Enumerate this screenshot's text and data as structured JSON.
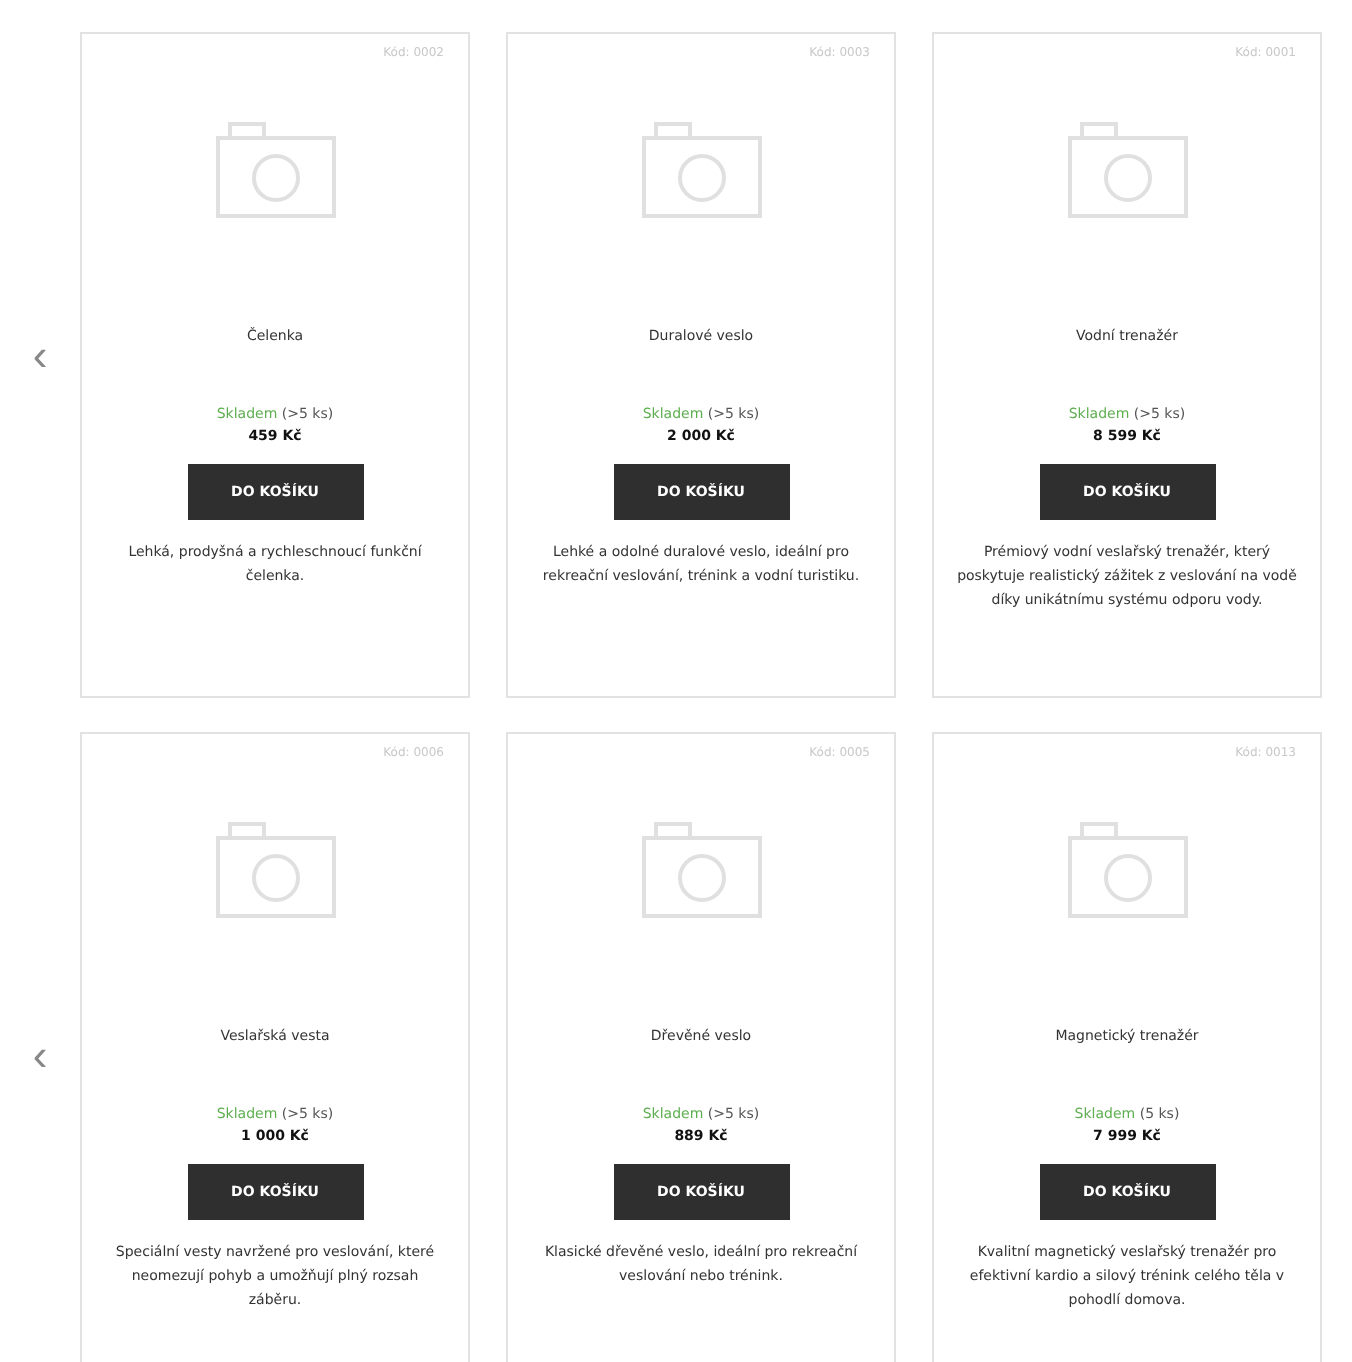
{
  "rows": [
    {
      "prev_arrow": "‹",
      "products": [
        {
          "code": "Kód: 0002",
          "name": "Čelenka",
          "stock_status": "Skladem",
          "stock_count": "(>5 ks)",
          "price": "459 Kč",
          "button": "DO KOŠÍKU",
          "description": "Lehká, prodyšná a rychleschnoucí funkční čelenka."
        },
        {
          "code": "Kód: 0003",
          "name": "Duralové veslo",
          "stock_status": "Skladem",
          "stock_count": "(>5 ks)",
          "price": "2 000 Kč",
          "button": "DO KOŠÍKU",
          "description": "Lehké a odolné duralové veslo, ideální pro rekreační veslování, trénink a vodní turistiku."
        },
        {
          "code": "Kód: 0001",
          "name": "Vodní trenažér",
          "stock_status": "Skladem",
          "stock_count": "(>5 ks)",
          "price": "8 599 Kč",
          "button": "DO KOŠÍKU",
          "description": "Prémiový vodní veslařský trenažér, který poskytuje realistický zážitek z veslování na vodě díky unikátnímu systému odporu vody."
        }
      ]
    },
    {
      "prev_arrow": "‹",
      "products": [
        {
          "code": "Kód: 0006",
          "name": "Veslařská vesta",
          "stock_status": "Skladem",
          "stock_count": "(>5 ks)",
          "price": "1 000 Kč",
          "button": "DO KOŠÍKU",
          "description": "Speciální vesty navržené pro veslování, které neomezují pohyb a umožňují plný rozsah záběru."
        },
        {
          "code": "Kód: 0005",
          "name": "Dřevěné veslo",
          "stock_status": "Skladem",
          "stock_count": "(>5 ks)",
          "price": "889 Kč",
          "button": "DO KOŠÍKU",
          "description": "Klasické dřevěné veslo, ideální pro rekreační veslování nebo trénink."
        },
        {
          "code": "Kód: 0013",
          "name": "Magnetický trenažér",
          "stock_status": "Skladem",
          "stock_count": "(5 ks)",
          "price": "7 999 Kč",
          "button": "DO KOŠÍKU",
          "description": "Kvalitní magnetický veslařský trenažér pro efektivní kardio a silový trénink celého těla v pohodlí domova."
        }
      ]
    }
  ]
}
